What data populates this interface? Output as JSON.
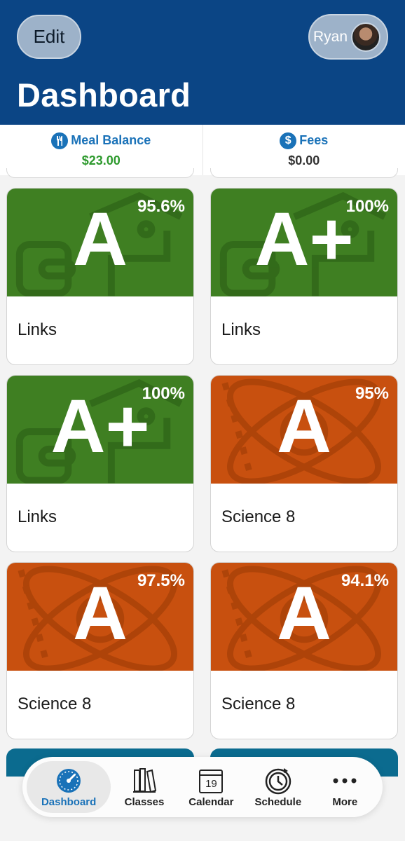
{
  "header": {
    "edit_label": "Edit",
    "profile_name": "Ryan",
    "title": "Dashboard"
  },
  "balances": {
    "meal_label": "Meal Balance",
    "meal_value": "$23.00",
    "fees_label": "Fees",
    "fees_value": "$0.00",
    "meal_icon": "utensils-icon",
    "fees_icon": "dollar-icon"
  },
  "cards": [
    {
      "grade": "A",
      "percent": "95.6%",
      "title": "Links",
      "color": "#3f7f22"
    },
    {
      "grade": "A+",
      "percent": "100%",
      "title": "Links",
      "color": "#3f7f22"
    },
    {
      "grade": "A+",
      "percent": "100%",
      "title": "Links",
      "color": "#3f7f22"
    },
    {
      "grade": "A",
      "percent": "95%",
      "title": "Science 8",
      "color": "#c8500f"
    },
    {
      "grade": "A",
      "percent": "97.5%",
      "title": "Science 8",
      "color": "#c8500f"
    },
    {
      "grade": "A",
      "percent": "94.1%",
      "title": "Science 8",
      "color": "#c8500f"
    }
  ],
  "nav": {
    "items": [
      {
        "label": "Dashboard",
        "icon": "gauge-icon",
        "active": true
      },
      {
        "label": "Classes",
        "icon": "books-icon",
        "active": false
      },
      {
        "label": "Calendar",
        "icon": "calendar-icon",
        "active": false
      },
      {
        "label": "Schedule",
        "icon": "clock-icon",
        "active": false
      },
      {
        "label": "More",
        "icon": "ellipsis-icon",
        "active": false
      }
    ],
    "calendar_day": "19"
  },
  "colors": {
    "header": "#0b4585",
    "accent": "#1a72b8",
    "green": "#3f7f22",
    "orange": "#c8500f",
    "meal_value": "#2e9a2e"
  }
}
